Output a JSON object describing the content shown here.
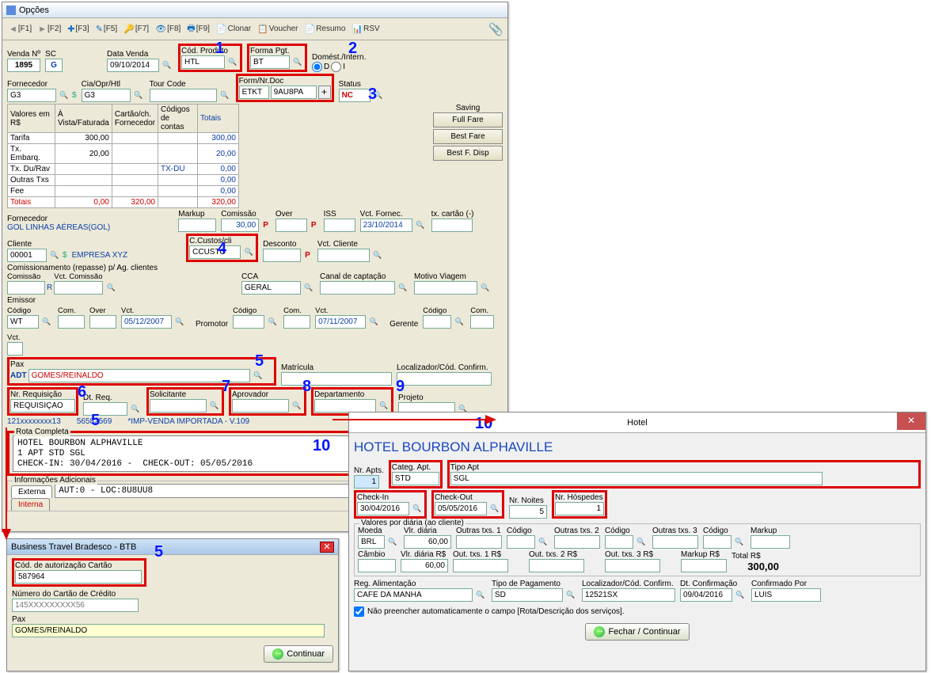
{
  "main": {
    "title": "Opções",
    "toolbar": {
      "f1": "[F1]",
      "f2": "[F2]",
      "f3": "[F3]",
      "f5": "[F5]",
      "f7": "[F7]",
      "f8": "[F8]",
      "f9": "[F9]",
      "clonar": "Clonar",
      "voucher": "Voucher",
      "resumo": "Resumo",
      "rsv": "RSV"
    },
    "annotations": {
      "a1": "1",
      "a2": "2",
      "a3": "3",
      "a4": "4",
      "a5": "5",
      "a6": "6",
      "a7": "7",
      "a8": "8",
      "a9": "9",
      "a10": "10",
      "a10b": "10",
      "a5b": "5",
      "a5c": "5"
    },
    "venda_n_lbl": "Venda Nº",
    "venda_n": "1895",
    "sc_lbl": "SC",
    "sc": "G",
    "data_venda_lbl": "Data Venda",
    "data_venda": "09/10/2014",
    "cod_produto_lbl": "Cód. Produto",
    "cod_produto": "HTL",
    "forma_pgt_lbl": "Forma Pgt.",
    "forma_pgt": "BT",
    "domest_lbl": "Domést./Intern.",
    "dom_d": "D",
    "dom_i": "I",
    "fornecedor_lbl": "Fornecedor",
    "fornecedor": "G3",
    "cia_lbl": "Cia/Opr/Htl",
    "cia": "G3",
    "tourcode_lbl": "Tour Code",
    "tourcode": "",
    "form_nrdoc_lbl": "Form/Nr.Doc",
    "form": "ETKT",
    "nrdoc": "9AU8PA",
    "status_lbl": "Status",
    "status": "NC",
    "saving_lbl": "Saving",
    "full_fare": "Full Fare",
    "best_fare": "Best Fare",
    "best_f_disp": "Best F. Disp",
    "valores_h": [
      "Valores em R$",
      "À Vista/Faturada",
      "Cartão/ch. Fornecedor",
      "Códigos de contas",
      "Totais"
    ],
    "valores_rows": [
      {
        "n": "Tarifa",
        "av": "300,00",
        "cf": "",
        "cod": "",
        "tot": "300,00"
      },
      {
        "n": "Tx. Embarq.",
        "av": "20,00",
        "cf": "",
        "cod": "",
        "tot": "20,00"
      },
      {
        "n": "Tx. Du/Rav",
        "av": "",
        "cf": "",
        "cod": "TX-DU",
        "tot": "0,00"
      },
      {
        "n": "Outras Txs",
        "av": "",
        "cf": "",
        "cod": "",
        "tot": "0,00"
      },
      {
        "n": "Fee",
        "av": "",
        "cf": "",
        "cod": "",
        "tot": "0,00"
      }
    ],
    "totais_lbl": "Totais",
    "tot_av": "0,00",
    "tot_cf": "320,00",
    "tot_all": "320,00",
    "fornecedor2_lbl": "Fornecedor",
    "fornecedor2": "GOL LINHAS AÉREAS(GOL)",
    "markup_lbl": "Markup",
    "markup": "",
    "comissao_lbl": "Comissão",
    "comissao": "30,00",
    "over_lbl": "Over",
    "over": "",
    "iss_lbl": "ISS",
    "iss": "",
    "vct_fornec_lbl": "Vct. Fornec.",
    "vct_fornec": "23/10/2014",
    "tx_cartao_lbl": "tx. cartão (-)",
    "tx_cartao": "",
    "cliente_lbl": "Cliente",
    "cliente": "00001",
    "cliente_nome": "EMPRESA XYZ",
    "ccustos_lbl": "C.Custos/cli",
    "ccustos": "CCUSTO",
    "desconto_lbl": "Desconto",
    "desconto": "",
    "vct_cliente_lbl": "Vct. Cliente",
    "vct_cliente": "",
    "comiss_rep_lbl": "Comissionamento (repasse) p/ Ag. clientes",
    "comissao_r_lbl": "Comissão",
    "comissao_r": "",
    "comissao_r_flag": "R",
    "vct_comissao_lbl": "Vct. Comissão",
    "vct_comissao": "",
    "cca_lbl": "CCA",
    "cca": "GERAL",
    "canal_lbl": "Canal de captação",
    "canal": "",
    "motivo_lbl": "Motivo Viagem",
    "motivo": "",
    "emissor_lbl": "Emissor",
    "emissor_cod_lbl": "Código",
    "emissor_cod": "WT",
    "com_lbl": "Com.",
    "vct_lbl": "Vct.",
    "emissor_vct": "05/12/2007",
    "promotor_lbl": "Promotor",
    "promotor_cod": "",
    "promotor_vct": "07/11/2007",
    "gerente_lbl": "Gerente",
    "gerente_cod": "",
    "pax_lbl": "Pax",
    "pax_type": "ADT",
    "pax_name": "GOMES/REINALDO",
    "matricula_lbl": "Matrícula",
    "matricula": "",
    "localizador_lbl": "Localizador/Cód. Confirm.",
    "localizador": "",
    "nr_req_lbl": "Nr. Requisição",
    "nr_req": "REQUISIÇÃO",
    "dt_req_lbl": "Dt. Req.",
    "dt_req": "",
    "solicitante_lbl": "Solicitante",
    "solicitante": "",
    "aprovador_lbl": "Aprovador",
    "aprovador": "",
    "departamento_lbl": "Departamento",
    "departamento": "",
    "projeto_lbl": "Projeto",
    "projeto": "",
    "ref1": "121xxxxxxxx13",
    "ref2": "56582569",
    "ref3": "*IMP-VENDA IMPORTADA - V.109",
    "rota_lbl": "Rota Completa",
    "rota": "HOTEL BOURBON ALPHAVILLE\n1 APT STD SGL\nCHECK-IN: 30/04/2016 -  CHECK-OUT: 05/05/2016",
    "info_lbl": "Informações Adicionais",
    "tab_externa": "Externa",
    "tab_interna": "Interna",
    "info_ext": "AUT:0 - LOC:8U8UU8"
  },
  "btb": {
    "title": "Business Travel Bradesco - BTB",
    "cod_aut_lbl": "Cód. de autorização Cartão",
    "cod_aut": "587964",
    "num_cartao_lbl": "Número do Cartão de Crédito",
    "num_cartao": "145XXXXXXXXX56",
    "pax_lbl": "Pax",
    "pax": "GOMES/REINALDO",
    "continuar": "Continuar"
  },
  "hotel": {
    "title": "Hotel",
    "header": "HOTEL BOURBON ALPHAVILLE",
    "nr_apts_lbl": "Nr. Apts.",
    "nr_apts": "1",
    "categ_lbl": "Categ. Apt.",
    "categ": "STD",
    "tipo_lbl": "Tipo Apt",
    "tipo": "SGL",
    "checkin_lbl": "Check-In",
    "checkin": "30/04/2016",
    "checkout_lbl": "Check-Out",
    "checkout": "05/05/2016",
    "noites_lbl": "Nr. Noites",
    "noites": "5",
    "hospedes_lbl": "Nr. Hóspedes",
    "hospedes": "1",
    "valores_lbl": "Valores por diária (ao cliente)",
    "moeda_lbl": "Moeda",
    "moeda": "BRL",
    "vlr_diaria_lbl": "Vlr. diária",
    "vlr_diaria": "60,00",
    "outras1_lbl": "Outras txs. 1",
    "codigo_lbl": "Código",
    "outras2_lbl": "Outras txs. 2",
    "outras3_lbl": "Outras txs. 3",
    "markup_lbl": "Markup",
    "cambio_lbl": "Câmbio",
    "cambio": "",
    "vlr_diaria_rs_lbl": "Vlr. diária R$",
    "vlr_diaria_rs": "60,00",
    "out1rs_lbl": "Out. txs. 1 R$",
    "out2rs_lbl": "Out. txs. 2 R$",
    "out3rs_lbl": "Out. txs. 3 R$",
    "markuprs_lbl": "Markup R$",
    "total_lbl": "Total R$",
    "total": "300,00",
    "reg_alim_lbl": "Reg. Alimentação",
    "reg_alim": "CAFÉ DA MANHÃ",
    "tipo_pag_lbl": "Tipo de Pagamento",
    "tipo_pag": "SD",
    "loc_lbl": "Localizador/Cód. Confirm.",
    "loc": "12521SX",
    "dt_conf_lbl": "Dt. Confirmação",
    "dt_conf": "09/04/2016",
    "conf_por_lbl": "Confirmado Por",
    "conf_por": "LUIS",
    "chk_lbl": "Não preencher automaticamente o campo [Rota/Descrição dos serviços].",
    "fechar": "Fechar / Continuar"
  }
}
